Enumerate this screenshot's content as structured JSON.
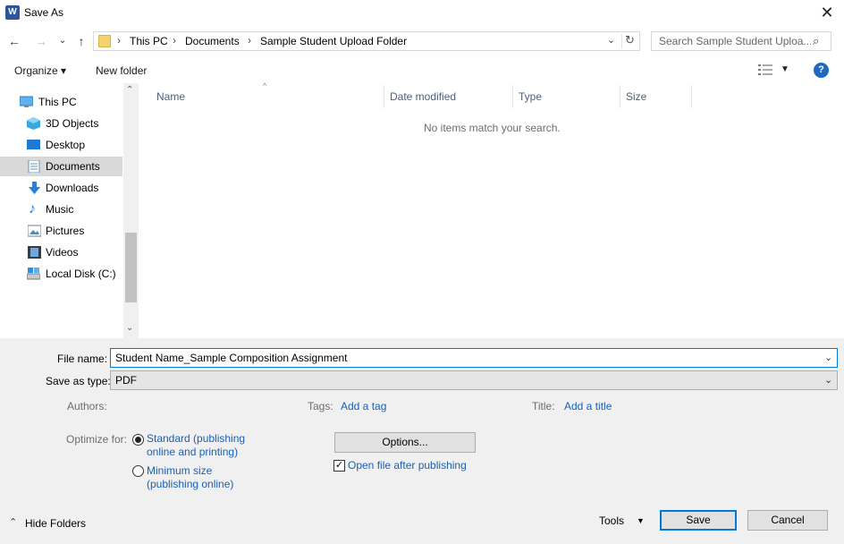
{
  "window": {
    "title": "Save As",
    "app_icon": "word-icon",
    "close_icon": "close-icon"
  },
  "nav": {
    "back_icon": "arrow-left-icon",
    "forward_icon": "arrow-right-icon",
    "recent_icon": "chevron-down-icon",
    "up_icon": "arrow-up-icon"
  },
  "address": {
    "breadcrumbs": [
      "This PC",
      "Documents",
      "Sample Student Upload Folder"
    ],
    "separator": "›",
    "refresh_icon": "refresh-icon"
  },
  "search": {
    "placeholder": "Search Sample Student Uploa..."
  },
  "toolbar": {
    "organize_label": "Organize ▾",
    "new_folder_label": "New folder",
    "help_label": "?"
  },
  "sidebar": {
    "items": [
      {
        "label": "This PC",
        "icon": "computer-icon",
        "selected": false
      },
      {
        "label": "3D Objects",
        "icon": "cube-icon",
        "selected": false
      },
      {
        "label": "Desktop",
        "icon": "desktop-icon",
        "selected": false
      },
      {
        "label": "Documents",
        "icon": "document-icon",
        "selected": true
      },
      {
        "label": "Downloads",
        "icon": "download-icon",
        "selected": false
      },
      {
        "label": "Music",
        "icon": "music-icon",
        "selected": false
      },
      {
        "label": "Pictures",
        "icon": "picture-icon",
        "selected": false
      },
      {
        "label": "Videos",
        "icon": "video-icon",
        "selected": false
      },
      {
        "label": "Local Disk (C:)",
        "icon": "disk-icon",
        "selected": false
      }
    ]
  },
  "filelist": {
    "columns": [
      "Name",
      "Date modified",
      "Type",
      "Size"
    ],
    "empty_message": "No items match your search."
  },
  "form": {
    "file_name_label": "File name:",
    "file_name_value": "Student Name_Sample Composition Assignment",
    "save_type_label": "Save as type:",
    "save_type_value": "PDF",
    "authors_label": "Authors:",
    "tags_label": "Tags:",
    "tags_link": "Add a tag",
    "title_label": "Title:",
    "title_link": "Add a title",
    "optimize_label": "Optimize for:",
    "optimize_standard_line1": "Standard (publishing",
    "optimize_standard_line2": "online and printing)",
    "optimize_minimum_line1": "Minimum size",
    "optimize_minimum_line2": "(publishing online)",
    "options_button": "Options...",
    "open_after_label": "Open file after publishing",
    "open_after_checked": true
  },
  "footer": {
    "hide_folders_label": "Hide Folders",
    "tools_label": "Tools",
    "save_button": "Save",
    "cancel_button": "Cancel"
  }
}
